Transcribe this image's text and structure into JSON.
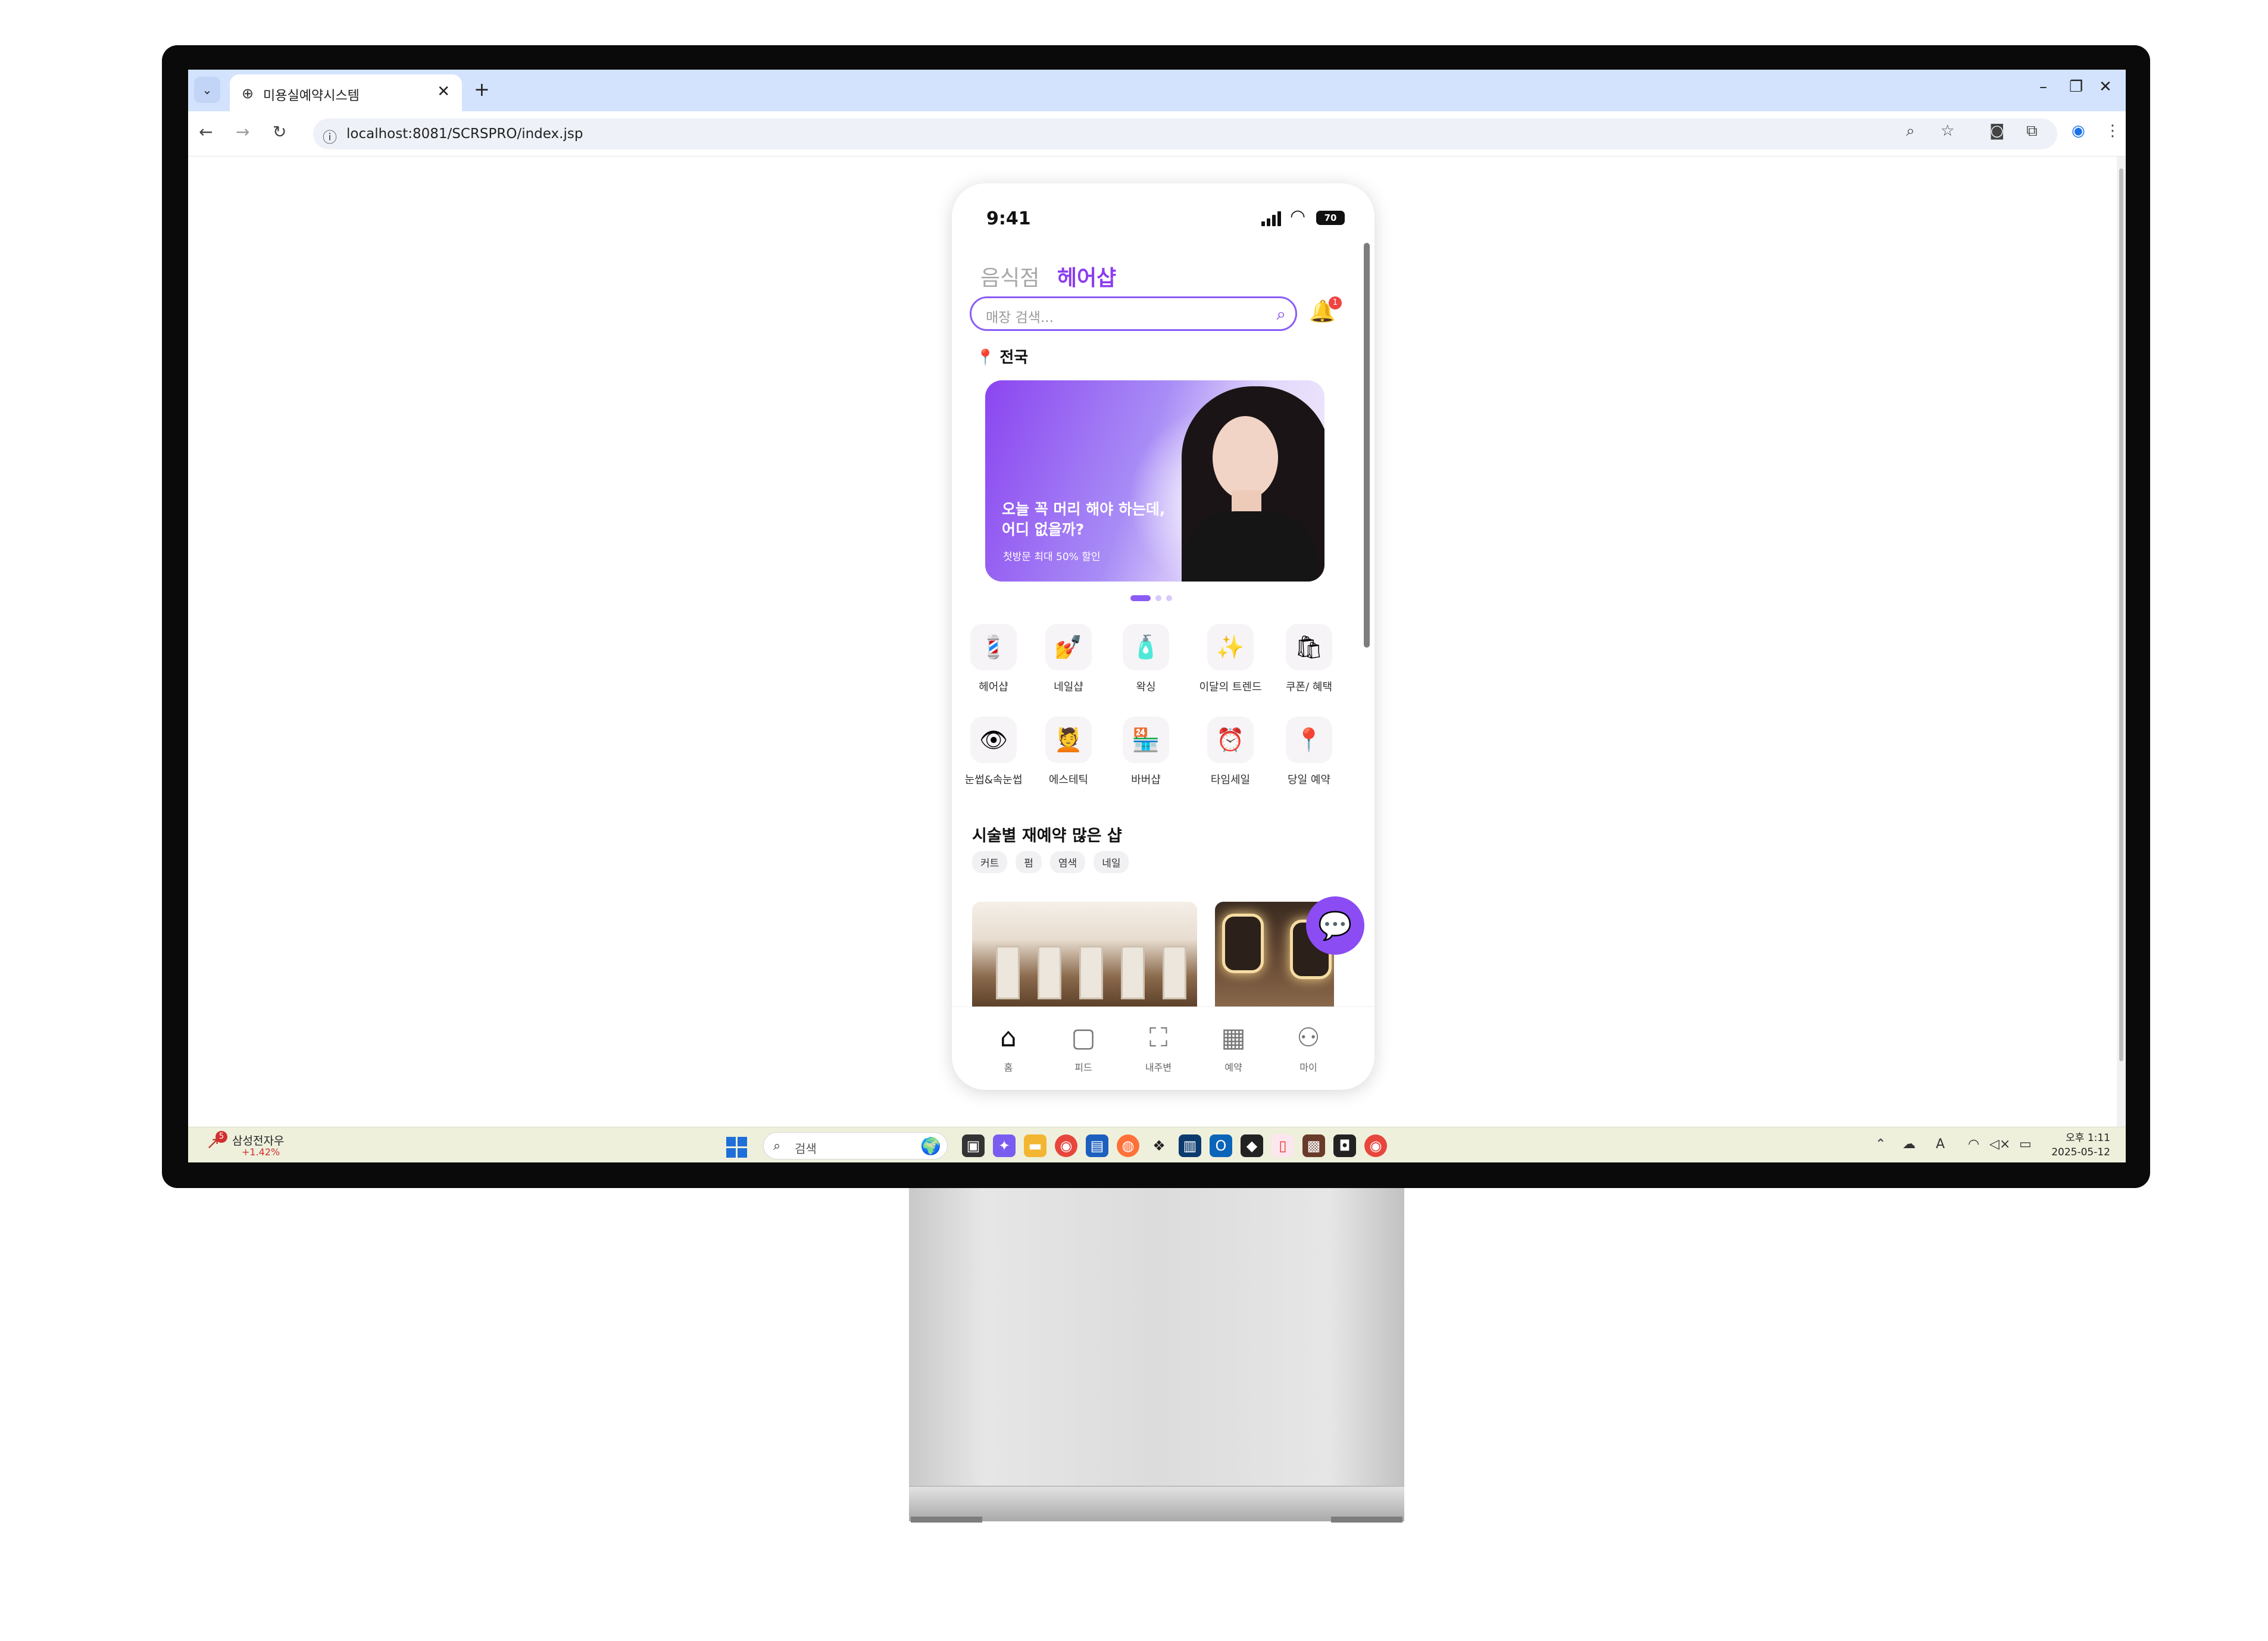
{
  "browser": {
    "tab_title": "미용실예약시스템",
    "url": "localhost:8081/SCRSPRO/index.jsp",
    "new_tab": "+",
    "tab_close": "✕",
    "tab_dropdown": "⌄"
  },
  "phone": {
    "status": {
      "time": "9:41",
      "battery": "70"
    },
    "category_tabs": [
      "음식점",
      "헤어샵"
    ],
    "active_tab_index": 1,
    "search": {
      "placeholder": "매장 검색..."
    },
    "notification_count": "1",
    "region": "전국",
    "banner": {
      "headline_1": "오늘 꼭 머리 해야 하는데,",
      "headline_2": "어디 없을까?",
      "sub": "첫방문 최대 50% 할인",
      "slide_count": 3,
      "active_slide": 1
    },
    "categories": [
      {
        "label": "헤어샵",
        "icon": "salon-icon",
        "glyph": "💈"
      },
      {
        "label": "네일샵",
        "icon": "nail-icon",
        "glyph": "💅"
      },
      {
        "label": "왁싱",
        "icon": "waxing-icon",
        "glyph": "🧴"
      },
      {
        "label": "이달의 트렌드",
        "icon": "trend-icon",
        "glyph": "✨"
      },
      {
        "label": "쿠폰/ 혜택",
        "icon": "coupon-icon",
        "glyph": "🛍"
      },
      {
        "label": "눈썹&속눈썹",
        "icon": "eyelash-icon",
        "glyph": "👁"
      },
      {
        "label": "에스테틱",
        "icon": "aesthetic-icon",
        "glyph": "💆"
      },
      {
        "label": "바버샵",
        "icon": "barber-icon",
        "glyph": "🏪"
      },
      {
        "label": "타임세일",
        "icon": "timesale-icon",
        "glyph": "⏰"
      },
      {
        "label": "당일 예약",
        "icon": "sameday-icon",
        "glyph": "📍"
      }
    ],
    "section_title": "시술별 재예약 많은 샵",
    "chips": [
      "커트",
      "펌",
      "염색",
      "네일"
    ],
    "bottom_nav": [
      {
        "label": "홈",
        "icon": "home-icon",
        "glyph": "⌂"
      },
      {
        "label": "피드",
        "icon": "feed-icon",
        "glyph": "▢"
      },
      {
        "label": "내주변",
        "icon": "map-icon",
        "glyph": "⛶"
      },
      {
        "label": "예약",
        "icon": "calendar-icon",
        "glyph": "▦"
      },
      {
        "label": "마이",
        "icon": "user-icon",
        "glyph": "⚇"
      }
    ]
  },
  "taskbar": {
    "stock_name": "삼성전자우",
    "stock_change": "+1.42%",
    "stock_badge": "5",
    "search_placeholder": "검색",
    "clock_time": "오후 1:11",
    "clock_date": "2025-05-12"
  },
  "colors": {
    "accent": "#8b5cf6",
    "tabbar": "#d3e3fd",
    "taskbar": "#eef0dc"
  }
}
